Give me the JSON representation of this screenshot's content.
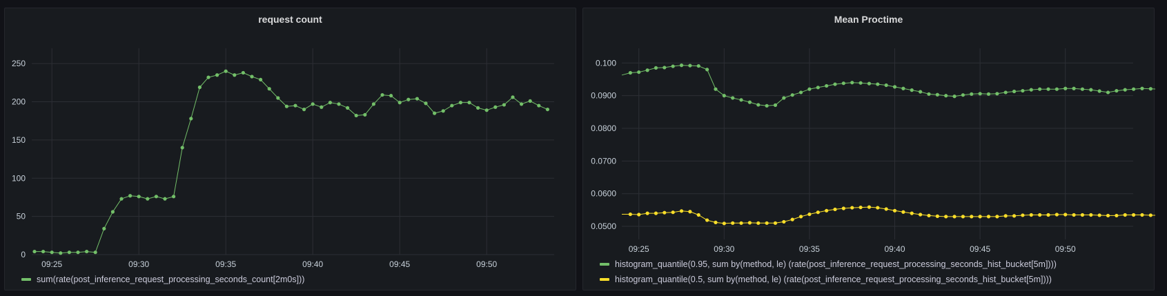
{
  "panels": [
    {
      "title": "request count",
      "chart_data": {
        "type": "line",
        "title": "request count",
        "xlabel": "",
        "ylabel": "",
        "x_ticks": [
          "09:25",
          "09:30",
          "09:35",
          "09:40",
          "09:45",
          "09:50"
        ],
        "y_ticks": [
          "0",
          "50",
          "100",
          "150",
          "200",
          "250"
        ],
        "ylim": [
          0,
          270
        ],
        "x_start": "09:24",
        "x_step_minutes": 0.5,
        "grid": true,
        "legend_position": "bottom-left",
        "series": [
          {
            "name": "sum(rate(post_inference_request_processing_seconds_count[2m0s]))",
            "color": "#73bf69",
            "values": [
              4,
              4,
              3,
              2,
              3,
              3,
              4,
              3,
              34,
              56,
              73,
              77,
              76,
              73,
              76,
              73,
              76,
              140,
              178,
              219,
              232,
              235,
              240,
              235,
              238,
              233,
              229,
              217,
              205,
              194,
              195,
              190,
              197,
              193,
              199,
              197,
              192,
              182,
              183,
              197,
              209,
              208,
              199,
              203,
              204,
              198,
              185,
              188,
              195,
              199,
              199,
              192,
              189,
              193,
              196,
              206,
              197,
              201,
              195,
              190
            ]
          }
        ]
      }
    },
    {
      "title": "Mean Proctime",
      "chart_data": {
        "type": "line",
        "title": "Mean Proctime",
        "xlabel": "",
        "ylabel": "",
        "x_ticks": [
          "09:25",
          "09:30",
          "09:35",
          "09:40",
          "09:45",
          "09:50"
        ],
        "y_ticks": [
          "0.0500",
          "0.0600",
          "0.0700",
          "0.0800",
          "0.0900",
          "0.100"
        ],
        "ylim": [
          0.046,
          0.1045
        ],
        "x_start": "09:24",
        "x_step_minutes": 0.5,
        "grid": true,
        "legend_position": "bottom-left",
        "series": [
          {
            "name": "histogram_quantile(0.95, sum by(method, le) (rate(post_inference_request_processing_seconds_hist_bucket[5m])))",
            "color": "#73bf69",
            "values": [
              0.0963,
              0.097,
              0.0972,
              0.0978,
              0.0985,
              0.0986,
              0.099,
              0.0993,
              0.0992,
              0.0991,
              0.098,
              0.092,
              0.09,
              0.0893,
              0.0887,
              0.088,
              0.0872,
              0.0869,
              0.0871,
              0.0893,
              0.0902,
              0.091,
              0.092,
              0.0925,
              0.093,
              0.0935,
              0.0938,
              0.094,
              0.0939,
              0.0937,
              0.0935,
              0.0932,
              0.0927,
              0.0922,
              0.0917,
              0.0912,
              0.0905,
              0.0903,
              0.09,
              0.0898,
              0.0902,
              0.0905,
              0.0906,
              0.0905,
              0.0906,
              0.091,
              0.0913,
              0.0915,
              0.0918,
              0.092,
              0.092,
              0.092,
              0.0922,
              0.0922,
              0.092,
              0.0918,
              0.0914,
              0.091,
              0.0915,
              0.0918,
              0.092,
              0.0922,
              0.0921,
              0.092
            ]
          },
          {
            "name": "histogram_quantile(0.5, sum by(method, le) (rate(post_inference_request_processing_seconds_hist_bucket[5m])))",
            "color": "#fade2a",
            "values": [
              0.0537,
              0.0537,
              0.0536,
              0.054,
              0.054,
              0.0542,
              0.0543,
              0.0547,
              0.0545,
              0.0535,
              0.0519,
              0.0512,
              0.0509,
              0.051,
              0.051,
              0.0511,
              0.051,
              0.051,
              0.051,
              0.0514,
              0.0521,
              0.053,
              0.0537,
              0.0543,
              0.0548,
              0.0552,
              0.0555,
              0.0557,
              0.0558,
              0.0559,
              0.0557,
              0.0553,
              0.0548,
              0.0544,
              0.054,
              0.0536,
              0.0533,
              0.0531,
              0.053,
              0.053,
              0.053,
              0.053,
              0.053,
              0.053,
              0.053,
              0.0532,
              0.0532,
              0.0534,
              0.0535,
              0.0535,
              0.0535,
              0.0536,
              0.0536,
              0.0535,
              0.0535,
              0.0535,
              0.0534,
              0.0533,
              0.0533,
              0.0535,
              0.0535,
              0.0535,
              0.0534,
              0.0534
            ]
          }
        ]
      }
    }
  ]
}
